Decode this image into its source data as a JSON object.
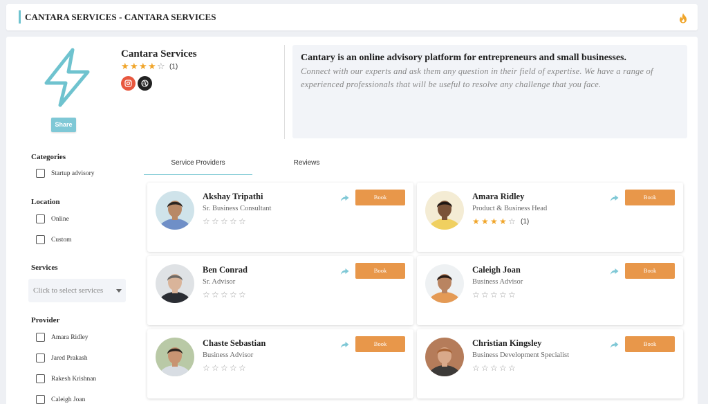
{
  "header": {
    "title": "CANTARA SERVICES - CANTARA SERVICES"
  },
  "business": {
    "name": "Cantara Services",
    "rating": 4,
    "rating_count": "(1)",
    "share_label": "Share",
    "about_title": "Cantary is an online advisory platform for entrepreneurs and small businesses.",
    "about_text": "Connect with our experts and ask them any question in their field of expertise. We have a range of experienced professionals that will be useful to resolve any challenge that you face."
  },
  "filters": {
    "categories_heading": "Categories",
    "categories": [
      "Startup advisory"
    ],
    "location_heading": "Location",
    "locations": [
      "Online",
      "Custom"
    ],
    "services_heading": "Services",
    "services_placeholder": "Click to select services",
    "provider_heading": "Provider",
    "providers": [
      "Amara Ridley",
      "Jared Prakash",
      "Rakesh Krishnan",
      "Caleigh Joan"
    ]
  },
  "tabs": [
    "Service Providers",
    "Reviews"
  ],
  "providers": [
    {
      "name": "Akshay Tripathi",
      "role": "Sr. Business Consultant",
      "rating": 0,
      "rating_count": "",
      "book": "Book"
    },
    {
      "name": "Amara Ridley",
      "role": "Product & Business Head",
      "rating": 4,
      "rating_count": "(1)",
      "book": "Book"
    },
    {
      "name": "Ben Conrad",
      "role": "Sr. Advisor",
      "rating": 0,
      "rating_count": "",
      "book": "Book"
    },
    {
      "name": "Caleigh Joan",
      "role": "Business Advisor",
      "rating": 0,
      "rating_count": "",
      "book": "Book"
    },
    {
      "name": "Chaste Sebastian",
      "role": "Business Advisor",
      "rating": 0,
      "rating_count": "",
      "book": "Book"
    },
    {
      "name": "Christian Kingsley",
      "role": "Business Development Specialist",
      "rating": 0,
      "rating_count": "",
      "book": "Book"
    }
  ],
  "colors": {
    "accent": "#6fc3cf",
    "book": "#e8974a",
    "star": "#f0a52a"
  },
  "icons": {
    "brand": "lightning-bolt-icon",
    "header": "flame-icon",
    "social": [
      "instagram-icon",
      "dribbble-icon"
    ],
    "card": "share-arrow-icon"
  }
}
